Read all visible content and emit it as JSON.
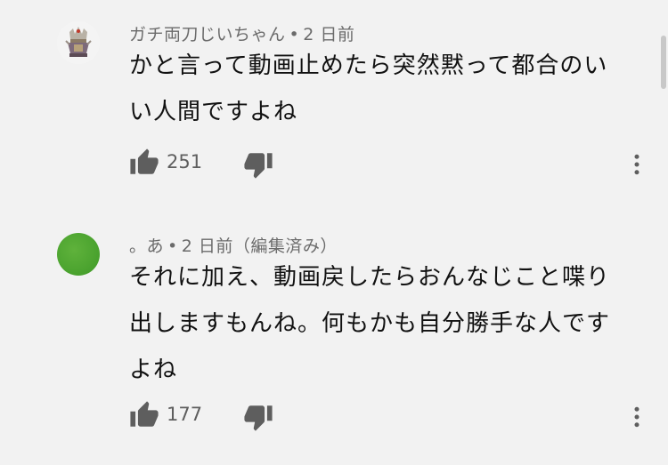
{
  "comments": [
    {
      "author": "ガチ両刀じいちゃん",
      "time": "2 日前",
      "text_lines": [
        "かと言って動画止めたら突然黙って都合のい",
        "い人間ですよね"
      ],
      "likes": "251",
      "avatar_icon": "crest-icon"
    },
    {
      "author": "。あ",
      "time": "2 日前（編集済み）",
      "text_lines": [
        "それに加え、動画戻したらおんなじこと喋り",
        "出しますもんね。何もかも自分勝手な人です",
        "よね"
      ],
      "likes": "177",
      "avatar_icon": "green-circle",
      "avatar_color": "#4ca830"
    }
  ],
  "separator": "•"
}
